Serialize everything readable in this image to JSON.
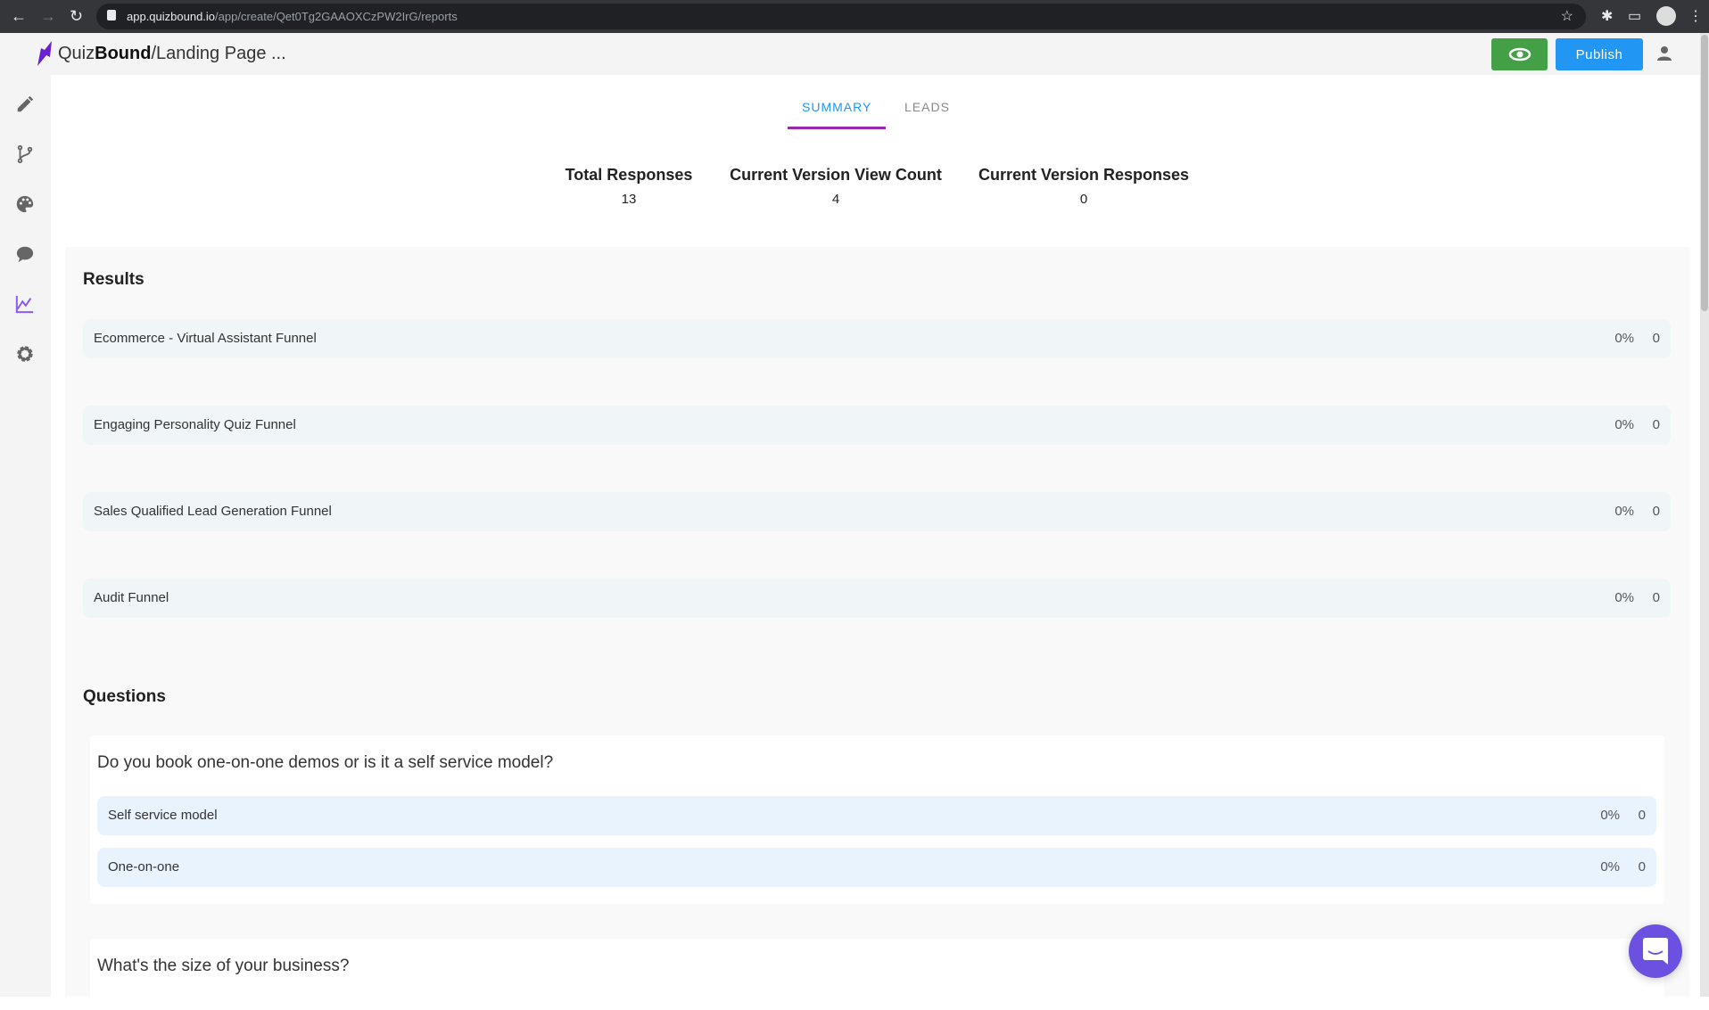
{
  "browser": {
    "url_host": "app.quizbound.io",
    "url_path": "/app/create/Qet0Tg2GAAOXCzPW2IrG/reports"
  },
  "header": {
    "brand_light": "Quiz",
    "brand_bold": "Bound",
    "breadcrumb": "/Landing Page ...",
    "publish_label": "Publish"
  },
  "sidebar": {
    "items": [
      {
        "icon": "pencil-icon"
      },
      {
        "icon": "branch-icon"
      },
      {
        "icon": "palette-icon"
      },
      {
        "icon": "comment-icon"
      },
      {
        "icon": "chart-icon",
        "active": true
      },
      {
        "icon": "gear-icon"
      }
    ]
  },
  "tabs": [
    {
      "label": "SUMMARY",
      "active": true
    },
    {
      "label": "LEADS"
    }
  ],
  "stats": [
    {
      "label": "Total Responses",
      "value": "13"
    },
    {
      "label": "Current Version View Count",
      "value": "4"
    },
    {
      "label": "Current Version Responses",
      "value": "0"
    }
  ],
  "results": {
    "title": "Results",
    "rows": [
      {
        "label": "Ecommerce - Virtual Assistant Funnel",
        "percent": "0%",
        "count": "0"
      },
      {
        "label": "Engaging Personality Quiz Funnel",
        "percent": "0%",
        "count": "0"
      },
      {
        "label": "Sales Qualified Lead Generation Funnel",
        "percent": "0%",
        "count": "0"
      },
      {
        "label": "Audit Funnel",
        "percent": "0%",
        "count": "0"
      }
    ]
  },
  "questions": {
    "title": "Questions",
    "items": [
      {
        "text": "Do you book one-on-one demos or is it a self service model?",
        "options": [
          {
            "label": "Self service model",
            "percent": "0%",
            "count": "0"
          },
          {
            "label": "One-on-one",
            "percent": "0%",
            "count": "0"
          }
        ]
      },
      {
        "text": "What's the size of your business?"
      }
    ]
  },
  "colors": {
    "accent": "#9c27b0",
    "tab_active": "#2196f3",
    "preview_green": "#43a047",
    "chat": "#6c51e0"
  }
}
